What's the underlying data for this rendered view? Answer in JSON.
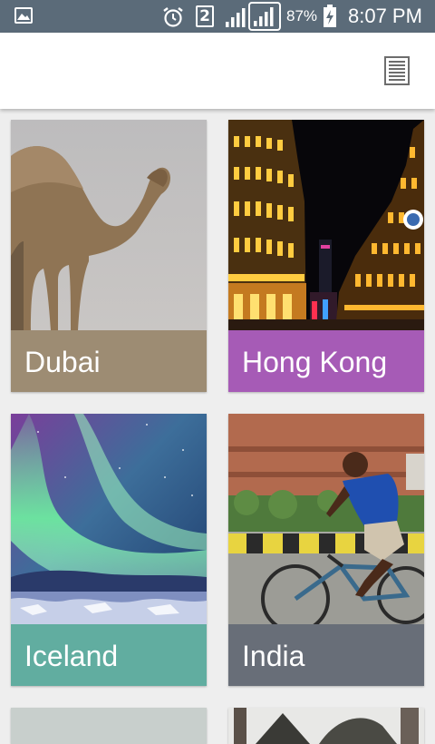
{
  "status_bar": {
    "battery_percent": "87%",
    "time": "8:07 PM",
    "sim_number": "2",
    "background_color": "#5b6b79",
    "icons": [
      "gallery-icon",
      "alarm-icon",
      "sim-icon",
      "signal-icon",
      "signal-icon",
      "battery-charging-icon"
    ]
  },
  "app_bar": {
    "menu_icon": "list-menu-icon"
  },
  "destinations": [
    {
      "name": "Dubai",
      "color": "#9d8c73"
    },
    {
      "name": "Hong Kong",
      "color": "#a65bb6"
    },
    {
      "name": "Iceland",
      "color": "#61ada0"
    },
    {
      "name": "India",
      "color": "#686e78"
    }
  ]
}
